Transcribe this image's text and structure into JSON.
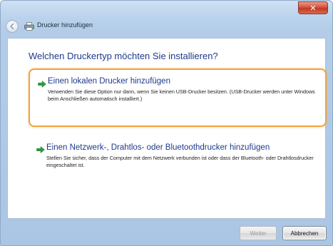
{
  "window": {
    "title": "Drucker hinzufügen",
    "close_symbol": "✕"
  },
  "main": {
    "heading": "Welchen Druckertyp möchten Sie installieren?",
    "options": [
      {
        "title": "Einen lokalen Drucker hinzufügen",
        "description": "Verwenden Sie diese Option nur dann, wenn Sie keinen USB-Drucker besitzen. (USB-Drucker werden unter Windows beim Anschließen automatisch installiert.)",
        "icon": "green-arrow-icon",
        "selected": true
      },
      {
        "title": "Einen Netzwerk-, Drahtlos- oder Bluetoothdrucker hinzufügen",
        "description": "Stellen Sie sicher, dass der Computer mit dem Netzwerk verbunden ist oder dass der Bluetooth- oder Drahtlosdrucker eingeschaltet ist.",
        "icon": "green-arrow-icon",
        "selected": false
      }
    ]
  },
  "footer": {
    "next_label": "Weiter",
    "cancel_label": "Abbrechen"
  },
  "colors": {
    "heading": "#1e3a8a",
    "selection_border": "#f2a33a",
    "arrow": "#2e9e3c",
    "close_button": "#c9452d"
  },
  "icons": [
    "back-arrow-icon",
    "printer-icon",
    "close-icon",
    "green-arrow-icon"
  ]
}
